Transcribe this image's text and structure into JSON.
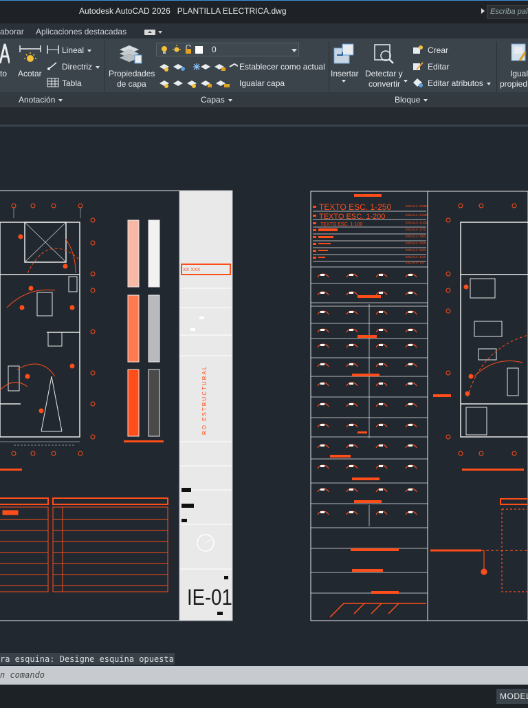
{
  "window": {
    "app_title": "Autodesk AutoCAD 2026",
    "file_name": "PLANTILLA ELECTRICA.dwg",
    "search_placeholder": "Escriba pala"
  },
  "ribbon_tabs": [
    {
      "label": "aborar"
    },
    {
      "label": "Aplicaciones destacadas"
    }
  ],
  "ribbon": {
    "anotacion": {
      "texto_label": "to",
      "acotar_label": "Acotar",
      "lineal_label": "Lineal",
      "directriz_label": "Directriz",
      "tabla_label": "Tabla",
      "panel_name": "Anotación"
    },
    "capas": {
      "propiedades_line1": "Propiedades",
      "propiedades_line2": "de capa",
      "current_layer": "0",
      "establecer_label": "Establecer como actual",
      "igualar_label": "Igualar capa",
      "panel_name": "Capas"
    },
    "bloque": {
      "insertar_label": "Insertar",
      "detectar_line1": "Detectar y",
      "detectar_line2": "convertir",
      "crear_label": "Crear",
      "editar_label": "Editar",
      "editar_atributos_label": "Editar atributos",
      "panel_name": "Bloque"
    },
    "propiedades": {
      "igualar_line1": "Igual",
      "igualar_line2": "propied"
    }
  },
  "drawing": {
    "sheet_code": "IE-01",
    "title_block_vertical": "RO  ESTRUCTURAL",
    "title_block_tag": "XX XXX",
    "legend_texts": [
      "TEXTO ESC. 1-250",
      "TEXTO ESC. 1-200",
      "TEXTO ESC. 1-100"
    ],
    "legend_scales": [
      "ESCALA: 1/250",
      "ESCALA: 1/200",
      "ESCALA: 1/100",
      "ESCALA: 1/75",
      "ESCALA: 1/50",
      "ESCALA: 1/25",
      "ESCALA: 1/20",
      "ESCALA: 1/10",
      "ESCALA: 1/5"
    ],
    "colors": {
      "background": "#212830",
      "accent": "#ff4e1a",
      "lines": "#e8e8e8",
      "sheet": "#e9e9e9"
    }
  },
  "command": {
    "history": "ra esquina: Designe esquina opuesta:",
    "prompt": "n comando"
  },
  "status": {
    "model_label": "MODEL"
  }
}
